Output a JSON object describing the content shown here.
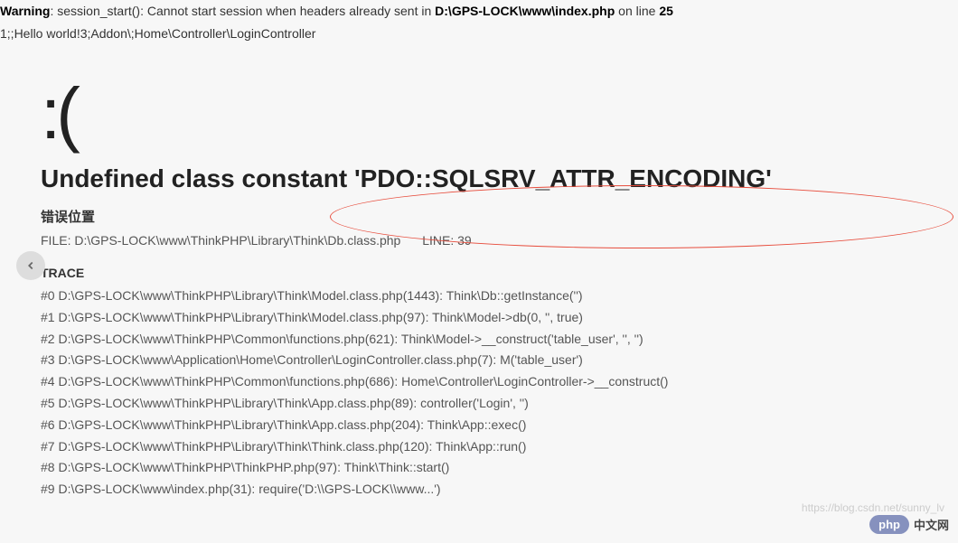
{
  "warning": {
    "label": "Warning",
    "message": ": session_start(): Cannot start session when headers already sent in ",
    "file": "D:\\GPS-LOCK\\www\\index.php",
    "line_text": " on line ",
    "line_num": "25"
  },
  "extra_line": "1;;Hello world!3;Addon\\;Home\\Controller\\LoginController",
  "sad_face": ":(",
  "error_title": "Undefined class constant 'PDO::SQLSRV_ATTR_ENCODING'",
  "error_location_label": "错误位置",
  "file_label": "FILE: D:\\GPS-LOCK\\www\\ThinkPHP\\Library\\Think\\Db.class.php",
  "line_label": "LINE: 39",
  "trace_label": "TRACE",
  "trace": [
    "#0 D:\\GPS-LOCK\\www\\ThinkPHP\\Library\\Think\\Model.class.php(1443): Think\\Db::getInstance('')",
    "#1 D:\\GPS-LOCK\\www\\ThinkPHP\\Library\\Think\\Model.class.php(97): Think\\Model->db(0, '', true)",
    "#2 D:\\GPS-LOCK\\www\\ThinkPHP\\Common\\functions.php(621): Think\\Model->__construct('table_user', '', '')",
    "#3 D:\\GPS-LOCK\\www\\Application\\Home\\Controller\\LoginController.class.php(7): M('table_user')",
    "#4 D:\\GPS-LOCK\\www\\ThinkPHP\\Common\\functions.php(686): Home\\Controller\\LoginController->__construct()",
    "#5 D:\\GPS-LOCK\\www\\ThinkPHP\\Library\\Think\\App.class.php(89): controller('Login', '')",
    "#6 D:\\GPS-LOCK\\www\\ThinkPHP\\Library\\Think\\App.class.php(204): Think\\App::exec()",
    "#7 D:\\GPS-LOCK\\www\\ThinkPHP\\Library\\Think\\Think.class.php(120): Think\\App::run()",
    "#8 D:\\GPS-LOCK\\www\\ThinkPHP\\ThinkPHP.php(97): Think\\Think::start()",
    "#9 D:\\GPS-LOCK\\www\\index.php(31): require('D:\\\\GPS-LOCK\\\\www...')"
  ],
  "watermark": {
    "php": "php",
    "text": "中文网",
    "url": "https://blog.csdn.net/sunny_lv"
  }
}
